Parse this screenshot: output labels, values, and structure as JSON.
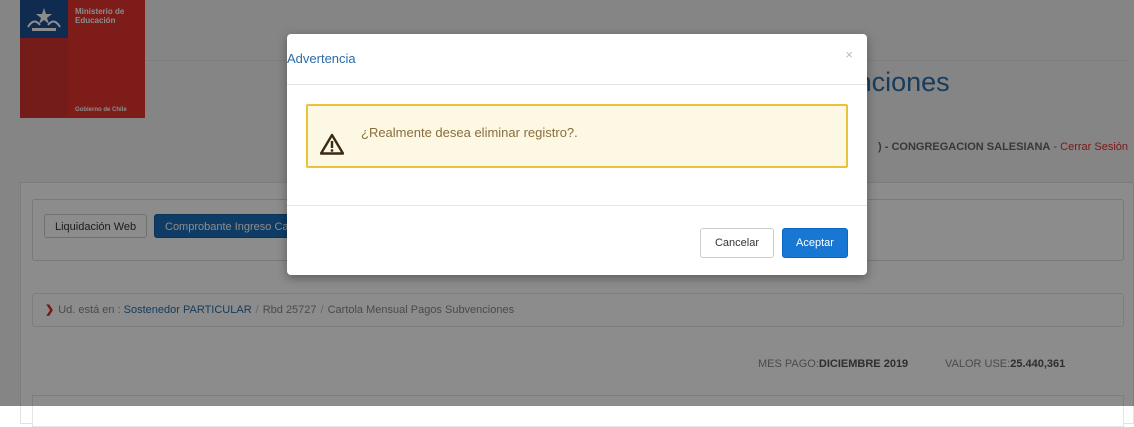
{
  "header": {
    "ministry": "Ministerio de Educación",
    "government": "Gobierno de Chile",
    "app_title": "ón Web Subvenciones",
    "user_info": ") - CONGREGACION SALESIANA",
    "logout_link": " - Cerrar Sesión"
  },
  "nav": {
    "liquidacion_label": "Liquidación Web",
    "comprobante_label": "Comprobante Ingreso Ca"
  },
  "breadcrumb": {
    "prefix": "Ud. está en :",
    "items": [
      "Sostenedor PARTICULAR",
      "Rbd 25727",
      "Cartola Mensual Pagos Subvenciones"
    ]
  },
  "summary": {
    "mes_label": "MES PAGO:",
    "mes_value": "DICIEMBRE 2019",
    "valor_label": "VALOR USE:",
    "valor_value": "25.440,361"
  },
  "modal": {
    "title": "Advertencia",
    "close_glyph": "×",
    "message": "¿Realmente desea eliminar registro?.",
    "cancel_label": "Cancelar",
    "accept_label": "Aceptar"
  },
  "colors": {
    "primary": "#1877d2",
    "link": "#2a6da9",
    "warning_border": "#e8c43c",
    "warning_bg": "#fcf8e3",
    "logo_red": "#e4332e",
    "logo_blue": "#1d4f93"
  }
}
